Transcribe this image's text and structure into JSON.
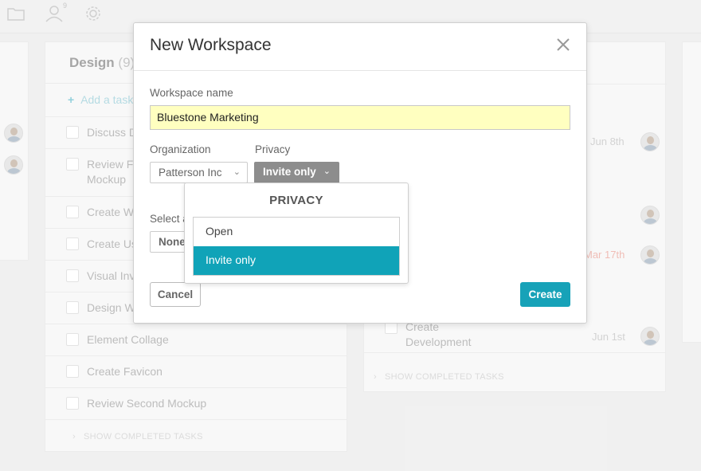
{
  "topbar": {
    "icons": [
      "folder-icon",
      "user-icon",
      "gear-icon"
    ],
    "user_badge": "9"
  },
  "board": {
    "design_column": {
      "title": "Design",
      "count": "(9)",
      "add_task_label": "Add a task",
      "tasks": [
        "Discuss De",
        "Review Fir Mockup",
        "Create Wi",
        "Create Us",
        "Visual Inve",
        "Design We",
        "Element Collage",
        "Create Favicon",
        "Review Second Mockup"
      ],
      "show_completed": "SHOW COMPLETED TASKS"
    },
    "middle_column": {
      "dates": [
        "Jun 8th",
        "Mar 17th"
      ],
      "task_create_dev": "Create Development",
      "task_create_dev_date": "Jun 1st",
      "show_completed": "SHOW COMPLETED TASKS"
    }
  },
  "modal": {
    "title": "New Workspace",
    "workspace_name_label": "Workspace name",
    "workspace_name_value": "Bluestone Marketing",
    "organization_label": "Organization",
    "organization_value": "Patterson Inc",
    "privacy_label": "Privacy",
    "privacy_value": "Invite only",
    "select_label_partial": "Select a",
    "select_value_partial": "None",
    "cancel_label": "Cancel",
    "create_label": "Create"
  },
  "privacy_dropdown": {
    "title": "PRIVACY",
    "options": [
      "Open",
      "Invite only"
    ],
    "selected": "Invite only"
  },
  "colors": {
    "accent": "#17a2b8",
    "selected_option": "#10a3b8",
    "input_highlight": "#ffffc0",
    "privacy_button": "#8d8d8d",
    "overdue_date": "#e89a8f"
  }
}
